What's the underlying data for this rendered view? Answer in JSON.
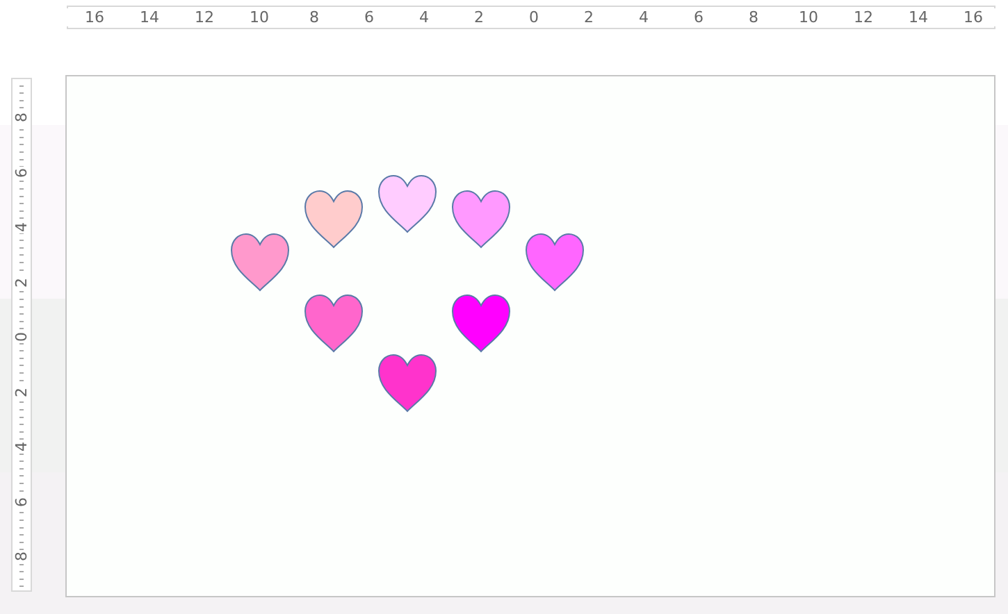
{
  "top_ruler": {
    "labels": [
      "16",
      "14",
      "12",
      "10",
      "8",
      "6",
      "4",
      "2",
      "0",
      "2",
      "4",
      "6",
      "8",
      "10",
      "12",
      "14",
      "16"
    ]
  },
  "left_ruler": {
    "labels": [
      "8",
      "6",
      "4",
      "2",
      "0",
      "2",
      "4",
      "6",
      "8"
    ]
  },
  "slide": {
    "hearts": [
      {
        "color": "#ff99cc"
      },
      {
        "color": "#ffcccc"
      },
      {
        "color": "#ffccff"
      },
      {
        "color": "#ff99ff"
      },
      {
        "color": "#ff66ff"
      },
      {
        "color": "#ff66cc"
      },
      {
        "color": "#ff00ff"
      },
      {
        "color": "#ff33cc"
      }
    ]
  }
}
